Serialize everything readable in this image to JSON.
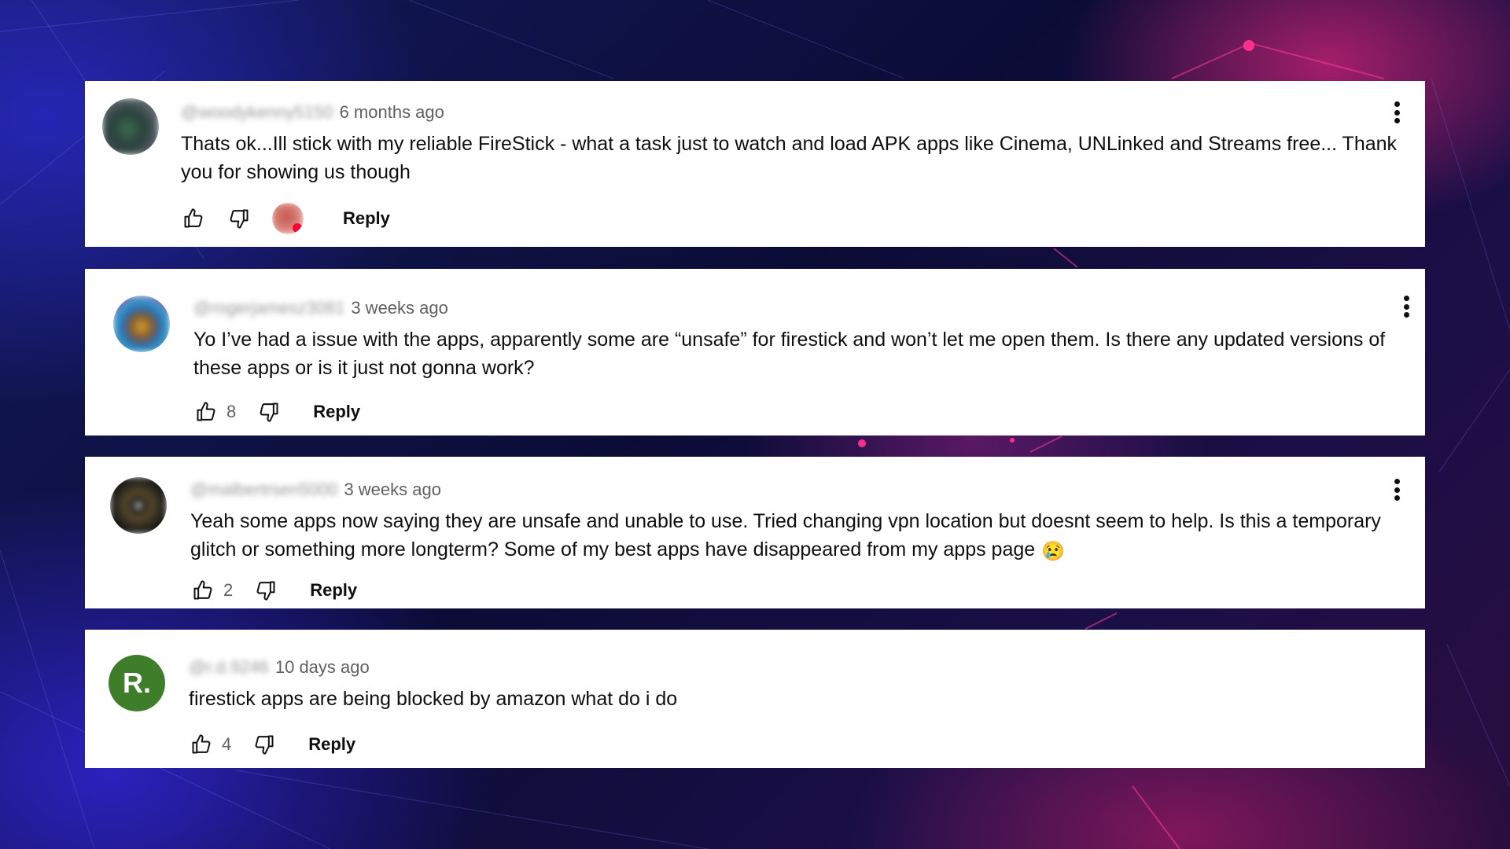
{
  "comments": [
    {
      "handle": "@woodykenny5150",
      "time": "6 months ago",
      "text": "Thats ok...Ill stick with my reliable FireStick - what a task just to watch and load APK apps like Cinema, UNLinked and Streams free... Thank you for showing us though",
      "likes": "",
      "reply_label": "Reply"
    },
    {
      "handle": "@rogerjamesz3081",
      "time": "3 weeks ago",
      "text": "Yo I’ve had a issue with the apps, apparently some are “unsafe” for firestick and won’t let me open them. Is there any updated versions of these apps or is it just not gonna work?",
      "likes": "8",
      "reply_label": "Reply"
    },
    {
      "handle": "@malbertrsen5000",
      "time": "3 weeks ago",
      "text": "Yeah some apps now saying they are unsafe and unable to use. Tried changing vpn location but doesnt seem to help. Is this a temporary glitch or something more longterm? Some of my best apps have disappeared from my apps page",
      "emoji": "😢",
      "likes": "2",
      "reply_label": "Reply"
    },
    {
      "handle": "@r.d.9246",
      "time": "10 days ago",
      "avatar_letter": "R.",
      "text": "firestick apps are being blocked by amazon what do i do",
      "likes": "4",
      "reply_label": "Reply"
    }
  ],
  "colors": {
    "card_bg": "#ffffff",
    "text": "#0f0f0f",
    "meta": "#606060",
    "avatar_r_bg": "#3e7d2a"
  },
  "icons": [
    "thumbs-up-icon",
    "thumbs-down-icon",
    "more-vert-icon",
    "creator-heart-avatar"
  ]
}
